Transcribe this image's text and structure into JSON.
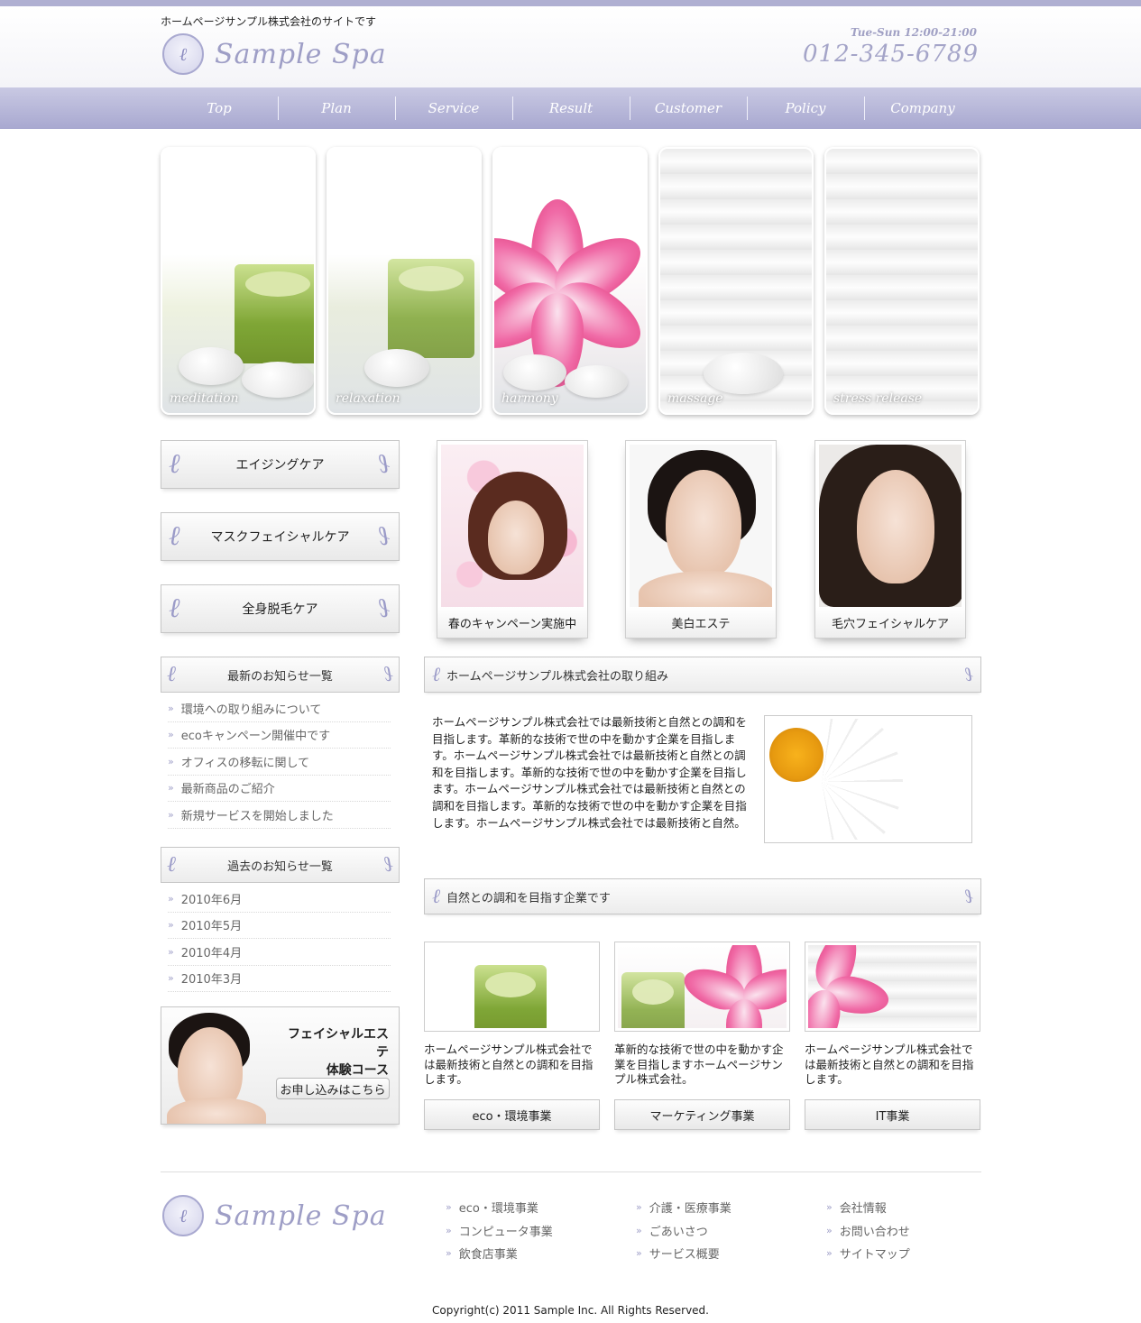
{
  "header": {
    "tagline": "ホームページサンプル株式会社のサイトです",
    "logo_text": "Sample Spa",
    "hours": "Tue-Sun 12:00-21:00",
    "phone": "012-345-6789"
  },
  "nav": {
    "items": [
      {
        "label": "Top"
      },
      {
        "label": "Plan"
      },
      {
        "label": "Service"
      },
      {
        "label": "Result"
      },
      {
        "label": "Customer"
      },
      {
        "label": "Policy"
      },
      {
        "label": "Company"
      }
    ]
  },
  "hero": {
    "panels": [
      {
        "label": "meditation"
      },
      {
        "label": "relaxation"
      },
      {
        "label": "harmony"
      },
      {
        "label": "massage"
      },
      {
        "label": "stress release"
      }
    ]
  },
  "sidebar": {
    "menu": [
      {
        "label": "エイジングケア"
      },
      {
        "label": "マスクフェイシャルケア"
      },
      {
        "label": "全身脱毛ケア"
      }
    ],
    "news_title": "最新のお知らせ一覧",
    "news": [
      "環境への取り組みについて",
      "ecoキャンペーン開催中です",
      "オフィスの移転に関して",
      "最新商品のご紹介",
      "新規サービスを開始しました"
    ],
    "archive_title": "過去のお知らせ一覧",
    "archive": [
      "2010年6月",
      "2010年5月",
      "2010年4月",
      "2010年3月"
    ],
    "promo": {
      "title_line1": "フェイシャルエステ",
      "title_line2": "体験コース",
      "button": "お申し込みはこちら"
    }
  },
  "cards": [
    {
      "caption": "春のキャンペーン実施中"
    },
    {
      "caption": "美白エステ"
    },
    {
      "caption": "毛穴フェイシャルケア"
    }
  ],
  "main": {
    "section1_title": "ホームページサンプル株式会社の取り組み",
    "intro": "ホームページサンプル株式会社では最新技術と自然との調和を目指します。革新的な技術で世の中を動かす企業を目指します。ホームページサンプル株式会社では最新技術と自然との調和を目指します。革新的な技術で世の中を動かす企業を目指します。ホームページサンプル株式会社では最新技術と自然との調和を目指します。革新的な技術で世の中を動かす企業を目指します。ホームページサンプル株式会社では最新技術と自然。",
    "section2_title": "自然との調和を目指す企業です",
    "business": [
      {
        "text": "ホームページサンプル株式会社では最新技術と自然との調和を目指します。",
        "button": "eco・環境事業"
      },
      {
        "text": "革新的な技術で世の中を動かす企業を目指しますホームページサンプル株式会社。",
        "button": "マーケティング事業"
      },
      {
        "text": "ホームページサンプル株式会社では最新技術と自然との調和を目指します。",
        "button": "IT事業"
      }
    ]
  },
  "footer": {
    "logo_text": "Sample Spa",
    "col1": [
      "eco・環境事業",
      "コンピュータ事業",
      "飲食店事業"
    ],
    "col2": [
      "介護・医療事業",
      "ごあいさつ",
      "サービス概要"
    ],
    "col3": [
      "会社情報",
      "お問い合わせ",
      "サイトマップ"
    ],
    "copyright": "Copyright(c) 2011 Sample Inc. All Rights Reserved."
  },
  "colors": {
    "accent": "#a8a8d0",
    "nav_top": "#c9c9e3",
    "logo": "#9e9ec6"
  }
}
